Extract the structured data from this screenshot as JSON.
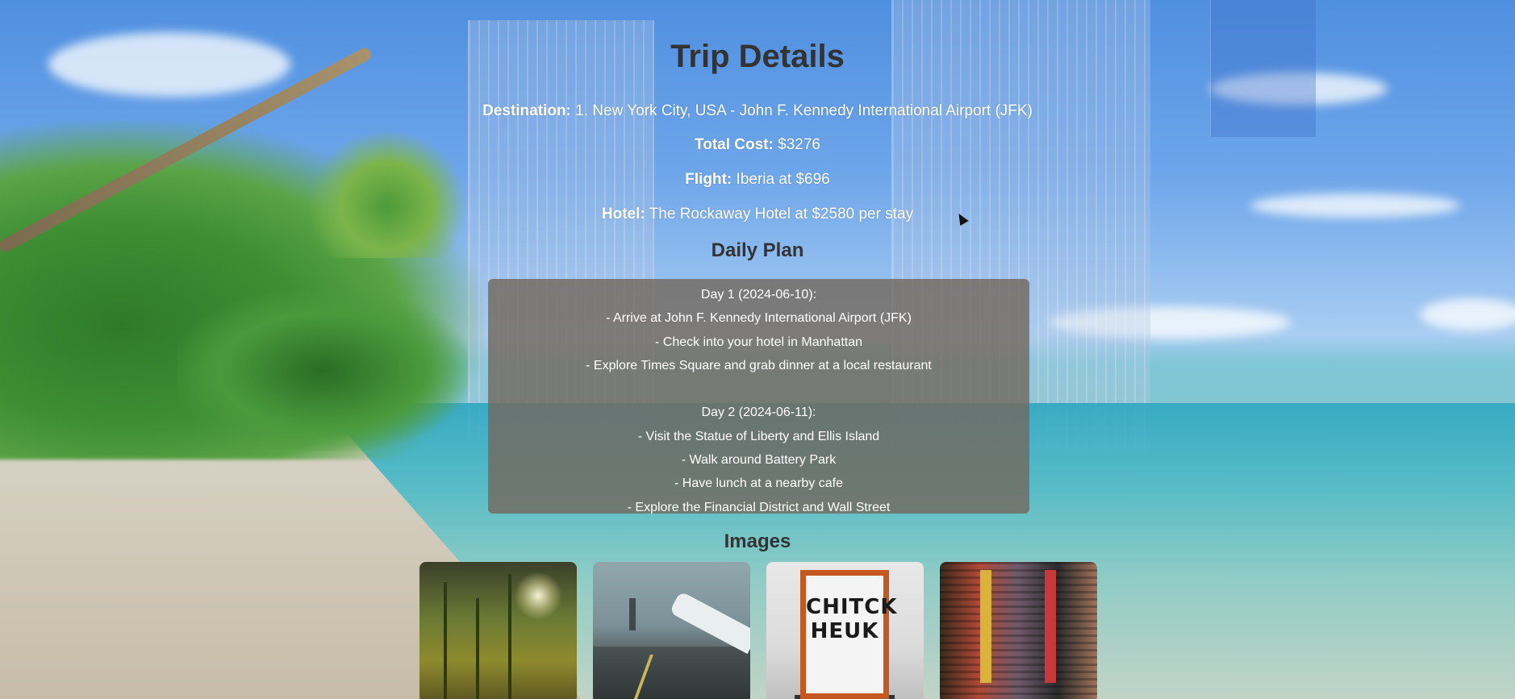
{
  "page": {
    "title": "Trip Details"
  },
  "details": {
    "destination_label": "Destination:",
    "destination_value": " 1. New York City, USA - John F. Kennedy International Airport (JFK)",
    "total_cost_label": "Total Cost:",
    "total_cost_value": " $3276",
    "flight_label": "Flight:",
    "flight_value": " Iberia at $696",
    "hotel_label": "Hotel:",
    "hotel_value": " The Rockaway Hotel at $2580 per stay"
  },
  "daily_plan": {
    "heading": "Daily Plan",
    "lines": [
      "Day 1 (2024-06-10):",
      "- Arrive at John F. Kennedy International Airport (JFK)",
      "- Check into your hotel in Manhattan",
      "- Explore Times Square and grab dinner at a local restaurant",
      "",
      "Day 2 (2024-06-11):",
      "- Visit the Statue of Liberty and Ellis Island",
      "- Walk around Battery Park",
      "- Have lunch at a nearby cafe",
      "- Explore the Financial District and Wall Street"
    ]
  },
  "images": {
    "heading": "Images",
    "items": [
      {
        "icon": "plants-sunlight-image"
      },
      {
        "icon": "airport-runway-image"
      },
      {
        "icon": "framed-sign-image",
        "text": "CHITCK HEUK"
      },
      {
        "icon": "city-street-image"
      }
    ]
  }
}
